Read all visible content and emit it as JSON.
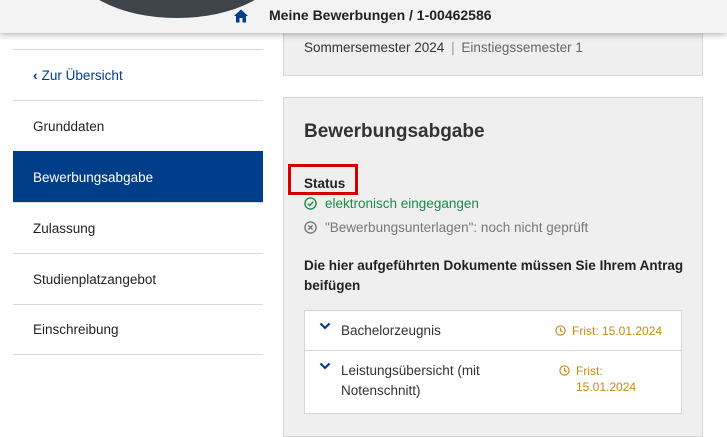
{
  "header": {
    "title": "Meine Bewerbungen / 1-00462586",
    "home_icon": "home-icon"
  },
  "sidebar": {
    "back_label": "Zur Übersicht",
    "items": [
      {
        "label": "Grunddaten",
        "active": false
      },
      {
        "label": "Bewerbungsabgabe",
        "active": true
      },
      {
        "label": "Zulassung",
        "active": false
      },
      {
        "label": "Studienplatzangebot",
        "active": false
      },
      {
        "label": "Einschreibung",
        "active": false
      }
    ]
  },
  "semester_card": {
    "semester": "Sommersemester 2024",
    "separator": "|",
    "entry_semester": "Einstiegssemester 1"
  },
  "main_card": {
    "title": "Bewerbungsabgabe",
    "status_label": "Status",
    "status_items": [
      {
        "text": "elektronisch eingegangen",
        "state": "ok",
        "icon": "check-circle-icon"
      },
      {
        "text": "\"Bewerbungsunterlagen\": noch nicht geprüft",
        "state": "pending",
        "icon": "x-circle-icon"
      }
    ],
    "documents_heading": "Die hier aufgeführten Dokumente müssen Sie Ihrem Antrag beifügen",
    "documents": [
      {
        "name": "Bachelorzeugnis",
        "deadline": "Frist: 15.01.2024"
      },
      {
        "name": "Leistungsübersicht (mit Notenschnitt)",
        "deadline": "Frist: 15.01.2024"
      }
    ]
  },
  "colors": {
    "primary": "#003e8a",
    "success": "#1e8a4a",
    "deadline": "#c78a12",
    "highlight": "#d40000"
  }
}
